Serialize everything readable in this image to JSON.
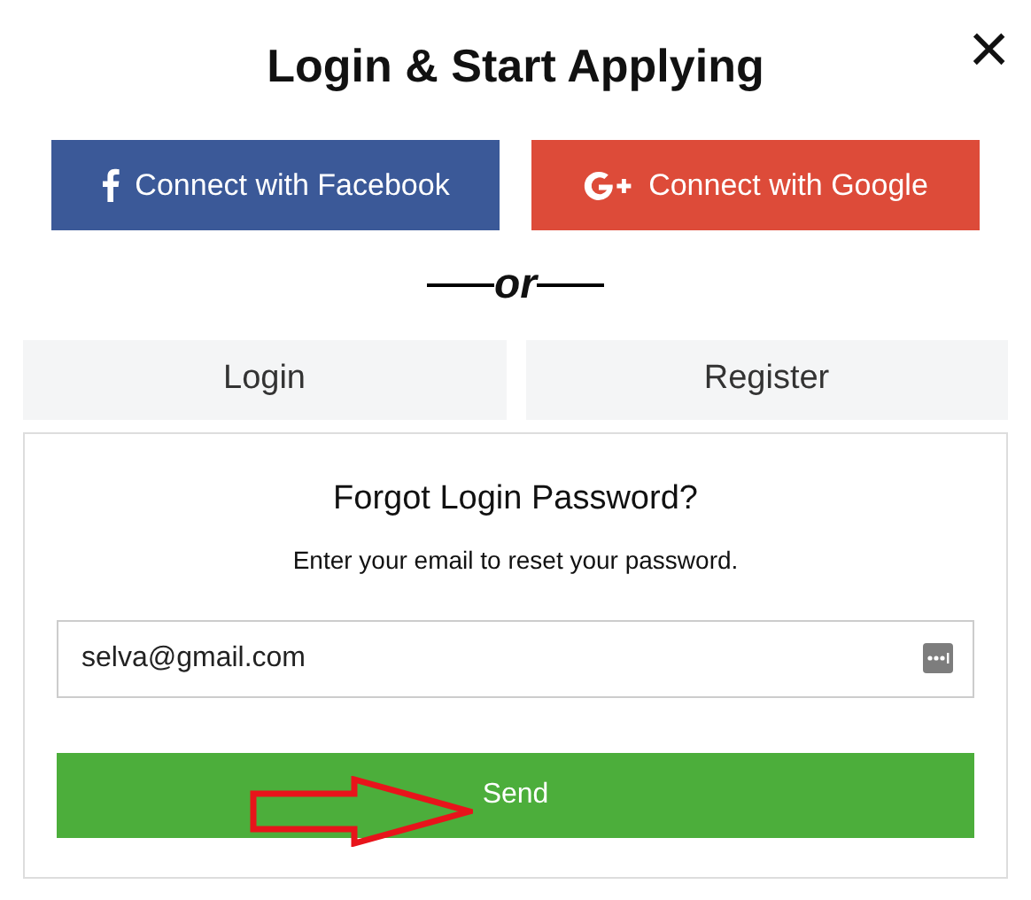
{
  "title": "Login & Start Applying",
  "close": "×",
  "social_buttons": [
    {
      "kind": "facebook",
      "label": "Connect with Facebook"
    },
    {
      "kind": "google",
      "label": "Connect with Google"
    }
  ],
  "divider": "or",
  "tabs": [
    {
      "label": "Login",
      "selected": false
    },
    {
      "label": "Register",
      "selected": false
    }
  ],
  "panel": {
    "heading": "Forgot Login Password?",
    "text": "Enter your email to reset your password.",
    "email": {
      "value": "selva@gmail.com"
    },
    "button": "Send",
    "annotation": {
      "kind": "arrow"
    }
  }
}
